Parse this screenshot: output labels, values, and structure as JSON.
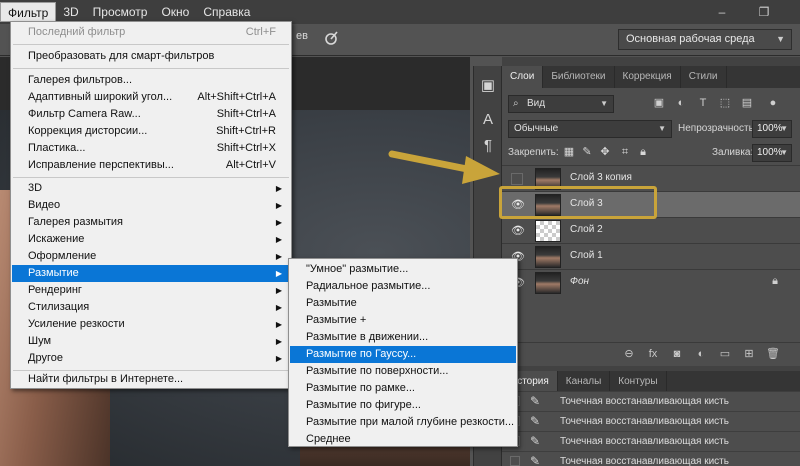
{
  "menubar": {
    "items": [
      "Фильтр",
      "3D",
      "Просмотр",
      "Окно",
      "Справка"
    ],
    "active_index": 0
  },
  "window_controls": {
    "minimize": "–",
    "restore": "❐"
  },
  "optionsbar": {
    "tail_text": "ев",
    "workspace": "Основная рабочая среда"
  },
  "filter_menu": {
    "items": [
      {
        "label": "Последний фильтр",
        "shortcut": "Ctrl+F",
        "disabled": true
      },
      {
        "label": "Преобразовать для смарт-фильтров",
        "shortcut": ""
      },
      {
        "label": "Галерея фильтров...",
        "shortcut": ""
      },
      {
        "label": "Адаптивный широкий угол...",
        "shortcut": "Alt+Shift+Ctrl+A"
      },
      {
        "label": "Фильтр Camera Raw...",
        "shortcut": "Shift+Ctrl+A"
      },
      {
        "label": "Коррекция дисторсии...",
        "shortcut": "Shift+Ctrl+R"
      },
      {
        "label": "Пластика...",
        "shortcut": "Shift+Ctrl+X"
      },
      {
        "label": "Исправление перспективы...",
        "shortcut": "Alt+Ctrl+V"
      },
      {
        "label": "3D",
        "submenu": true
      },
      {
        "label": "Видео",
        "submenu": true
      },
      {
        "label": "Галерея размытия",
        "submenu": true
      },
      {
        "label": "Искажение",
        "submenu": true
      },
      {
        "label": "Оформление",
        "submenu": true
      },
      {
        "label": "Размытие",
        "submenu": true,
        "highlighted": true
      },
      {
        "label": "Рендеринг",
        "submenu": true
      },
      {
        "label": "Стилизация",
        "submenu": true
      },
      {
        "label": "Усиление резкости",
        "submenu": true
      },
      {
        "label": "Шум",
        "submenu": true
      },
      {
        "label": "Другое",
        "submenu": true
      },
      {
        "label": "Найти фильтры в Интернете...",
        "shortcut": ""
      }
    ]
  },
  "blur_submenu": {
    "items": [
      "\"Умное\" размытие...",
      "Радиальное размытие...",
      "Размытие",
      "Размытие +",
      "Размытие в движении...",
      "Размытие по Гауссу...",
      "Размытие по поверхности...",
      "Размытие по рамке...",
      "Размытие по фигуре...",
      "Размытие при малой глубине резкости...",
      "Среднее"
    ],
    "highlighted_index": 5
  },
  "layers_panel": {
    "tabs": [
      "Слои",
      "Библиотеки",
      "Коррекция",
      "Стили"
    ],
    "active_tab": 0,
    "kind_filter": "Вид",
    "blend_mode": "Обычные",
    "opacity_label": "Непрозрачность:",
    "opacity_value": "100%",
    "lock_label": "Закрепить:",
    "fill_label": "Заливка:",
    "fill_value": "100%",
    "layers": [
      {
        "name": "Слой 3 копия",
        "visible": false,
        "selected": false,
        "thumb": "photo"
      },
      {
        "name": "Слой 3",
        "visible": true,
        "selected": true,
        "thumb": "photo"
      },
      {
        "name": "Слой 2",
        "visible": true,
        "selected": false,
        "thumb": "transparent"
      },
      {
        "name": "Слой 1",
        "visible": true,
        "selected": false,
        "thumb": "photo"
      },
      {
        "name": "Фон",
        "visible": true,
        "selected": false,
        "thumb": "photo",
        "italic": true,
        "locked": true
      }
    ]
  },
  "history_panel": {
    "tabs": [
      "История",
      "Каналы",
      "Контуры"
    ],
    "active_tab": 0,
    "entries": [
      "Точечная восстанавливающая кисть",
      "Точечная восстанавливающая кисть",
      "Точечная восстанавливающая кисть",
      "Точечная восстанавливающая кисть"
    ]
  },
  "colors": {
    "menu_highlight": "#0a76d6",
    "annotation": "#c9a43a"
  }
}
